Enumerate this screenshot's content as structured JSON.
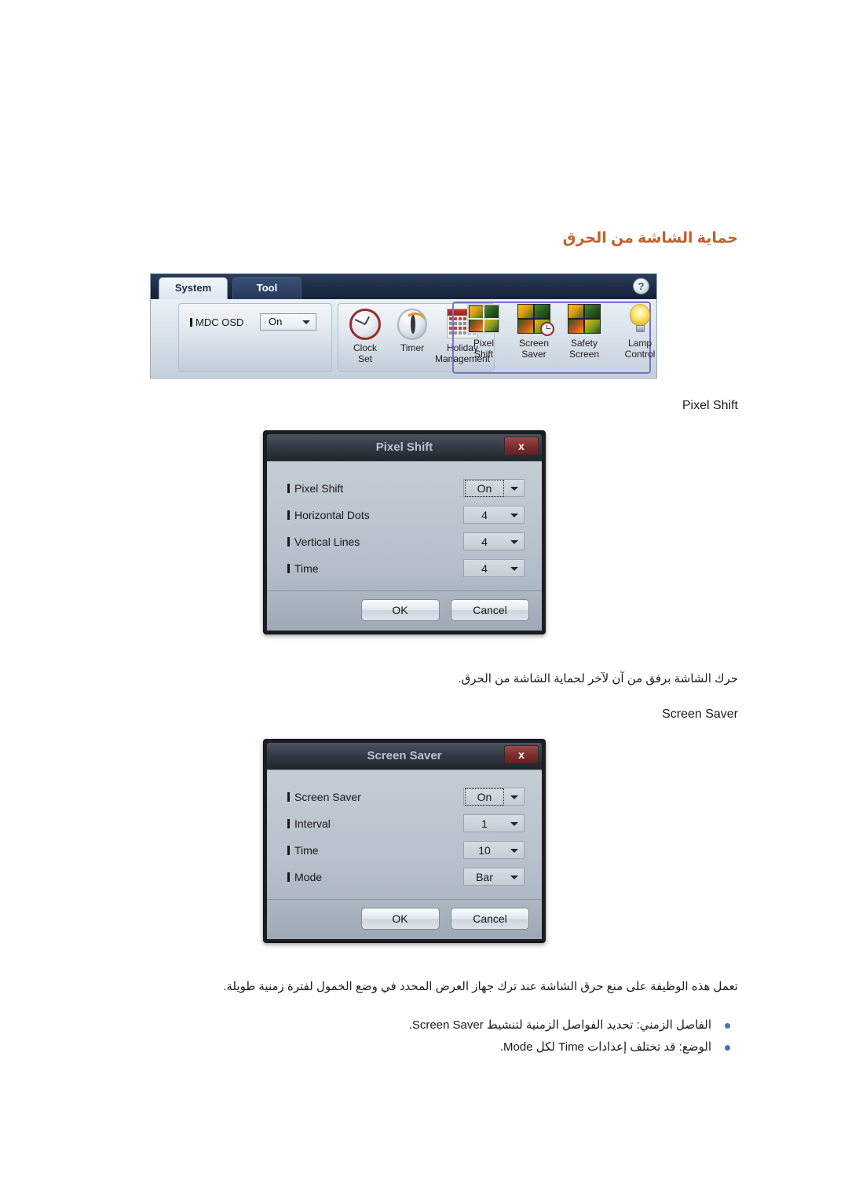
{
  "page": {
    "title_ar": "حماية الشاشة من الحرق",
    "title_color": "#c0622c"
  },
  "toolbar": {
    "tabs": [
      {
        "label": "System",
        "active": true
      },
      {
        "label": "Tool",
        "active": false
      }
    ],
    "help_icon": "?",
    "osd": {
      "label": "MDC OSD",
      "value": "On"
    },
    "items": [
      {
        "icon": "clock-set-icon",
        "line1": "Clock",
        "line2": "Set"
      },
      {
        "icon": "timer-icon",
        "line1": "Timer",
        "line2": ""
      },
      {
        "icon": "holiday-management-icon",
        "line1": "Holiday",
        "line2": "Management"
      },
      {
        "icon": "pixel-shift-icon",
        "line1": "Pixel",
        "line2": "Shift"
      },
      {
        "icon": "screen-saver-icon",
        "line1": "Screen",
        "line2": "Saver"
      },
      {
        "icon": "safety-screen-icon",
        "line1": "Safety",
        "line2": "Screen"
      },
      {
        "icon": "lamp-control-icon",
        "line1": "Lamp",
        "line2": "Control"
      }
    ],
    "highlight_color": "#7b72c4"
  },
  "section_pixel_shift": {
    "caption": "Pixel Shift",
    "note_ar": "حرك الشاشة برفق من آن لآخر لحماية الشاشة من الحرق.",
    "dialog": {
      "title": "Pixel Shift",
      "close_label": "x",
      "rows": [
        {
          "label": "Pixel Shift",
          "value": "On",
          "focused": true
        },
        {
          "label": "Horizontal Dots",
          "value": "4",
          "focused": false
        },
        {
          "label": "Vertical Lines",
          "value": "4",
          "focused": false
        },
        {
          "label": "Time",
          "value": "4",
          "focused": false
        }
      ],
      "ok_label": "OK",
      "cancel_label": "Cancel"
    }
  },
  "section_screen_saver": {
    "caption": "Screen Saver",
    "dialog": {
      "title": "Screen Saver",
      "close_label": "x",
      "rows": [
        {
          "label": "Screen Saver",
          "value": "On",
          "focused": true
        },
        {
          "label": "Interval",
          "value": "1",
          "focused": false
        },
        {
          "label": "Time",
          "value": "10",
          "focused": false
        },
        {
          "label": "Mode",
          "value": "Bar",
          "focused": false
        }
      ],
      "ok_label": "OK",
      "cancel_label": "Cancel"
    },
    "description_ar": "تعمل هذه الوظيفة على منع حرق الشاشة عند ترك جهاز العرض المحدد في وضع الخمول لفترة زمنية طويلة.",
    "bullets": [
      "الفاصل الزمني: تحديد الفواصل الزمنية لتنشيط Screen Saver.",
      "الوضع: قد تختلف إعدادات Time لكل Mode."
    ],
    "bullet_color": "#4a74ab"
  }
}
